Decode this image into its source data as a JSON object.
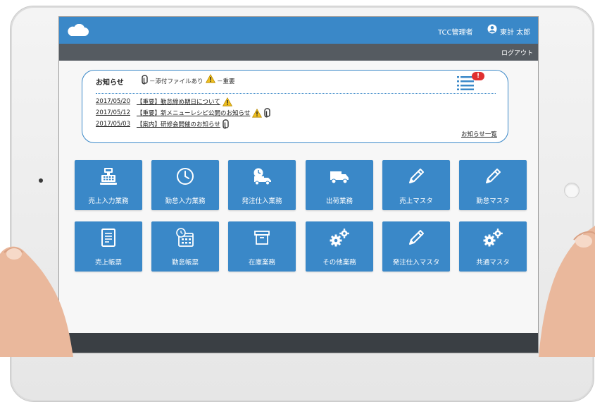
{
  "header": {
    "admin_label": "TCC管理者",
    "user_name": "東計 太郎",
    "logout_label": "ログアウト"
  },
  "notices": {
    "title": "お知らせ",
    "legend_attachment": "－添付ファイルあり",
    "legend_important": "－重要",
    "badge": "!",
    "items": [
      {
        "date": "2017/05/20",
        "title": "【重要】勤怠締め期日について"
      },
      {
        "date": "2017/05/12",
        "title": "【重要】新メニューレシピ公開のお知らせ"
      },
      {
        "date": "2017/05/03",
        "title": "【案内】研修会開催のお知らせ"
      }
    ],
    "more_label": "お知らせ一覧"
  },
  "tiles": [
    {
      "label": "売上入力業務",
      "icon": "cash-register-icon"
    },
    {
      "label": "勤怠入力業務",
      "icon": "clock-icon"
    },
    {
      "label": "発注仕入業務",
      "icon": "delivery-clock-truck-icon"
    },
    {
      "label": "出荷業務",
      "icon": "truck-icon"
    },
    {
      "label": "売上マスタ",
      "icon": "pencil-icon"
    },
    {
      "label": "勤怠マスタ",
      "icon": "pencil-icon"
    },
    {
      "label": "売上帳票",
      "icon": "document-icon"
    },
    {
      "label": "勤怠帳票",
      "icon": "calendar-clock-icon"
    },
    {
      "label": "在庫業務",
      "icon": "archive-box-icon"
    },
    {
      "label": "その他業務",
      "icon": "gears-icon"
    },
    {
      "label": "発注仕入マスタ",
      "icon": "pencil-icon"
    },
    {
      "label": "共通マスタ",
      "icon": "gears-icon"
    }
  ],
  "colors": {
    "primary": "#3a88c8",
    "subbar": "#555b61",
    "footer": "#3a3f44",
    "warning": "#f0c020",
    "badge": "#e03030"
  }
}
